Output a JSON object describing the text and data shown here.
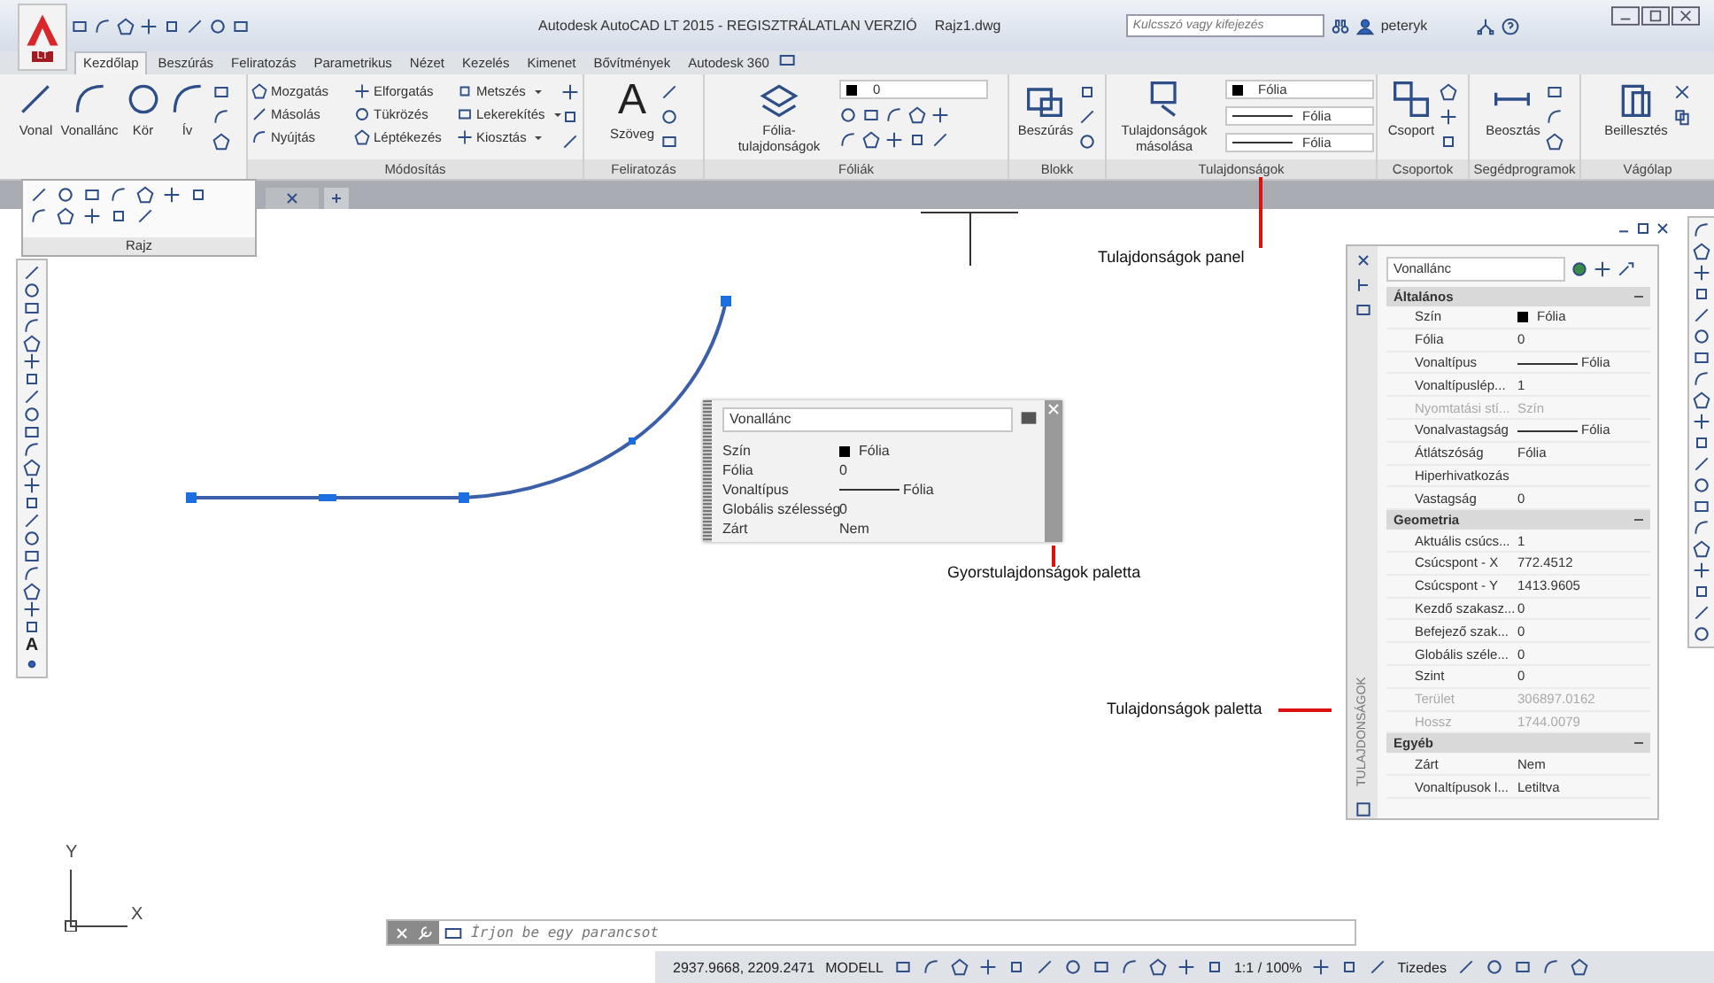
{
  "title_bar": {
    "app_badge": "LT",
    "title": "Autodesk AutoCAD LT 2015 - REGISZTRÁLATLAN VERZIÓ",
    "document": "Rajz1.dwg",
    "search": {
      "placeholder": "Kulcsszó vagy kifejezés"
    },
    "user": "peteryk"
  },
  "tabs": [
    {
      "label": "Kezdőlap",
      "selected": true
    },
    {
      "label": "Beszúrás",
      "selected": false
    },
    {
      "label": "Feliratozás",
      "selected": false
    },
    {
      "label": "Parametrikus",
      "selected": false
    },
    {
      "label": "Nézet",
      "selected": false
    },
    {
      "label": "Kezelés",
      "selected": false
    },
    {
      "label": "Kimenet",
      "selected": false
    },
    {
      "label": "Bővítmények",
      "selected": false
    },
    {
      "label": "Autodesk 360",
      "selected": false
    }
  ],
  "ribbon": {
    "draw": {
      "tools": [
        "Vonal",
        "Vonallánc",
        "Kör",
        "Ív"
      ]
    },
    "modify": {
      "title": "Módosítás",
      "tools": [
        "Mozgatás",
        "Elforgatás",
        "Metszés",
        "Másolás",
        "Tükrözés",
        "Lekerekítés",
        "Nyújtás",
        "Léptékezés",
        "Kiosztás"
      ]
    },
    "annotation": {
      "title": "Feliratozás",
      "tool": "Szöveg",
      "glyph": "A"
    },
    "layers": {
      "title": "Fóliák",
      "tool": "Fólia-tulajdonságok",
      "layer": "0"
    },
    "block": {
      "title": "Blokk",
      "tool": "Beszúrás"
    },
    "properties": {
      "title": "Tulajdonságok",
      "tool": "Tulajdonságok másolása",
      "color_text": "Fólia",
      "linetype": "Fólia",
      "lineweight": "Fólia"
    },
    "groups": {
      "title": "Csoportok",
      "tool": "Csoport"
    },
    "utilities": {
      "title": "Segédprogramok",
      "tool": "Beosztás"
    },
    "clipboard": {
      "title": "Vágólap",
      "tool": "Beillesztés"
    }
  },
  "draw_flyout": {
    "title": "Rajz"
  },
  "left_toolbar": {
    "glyph": "A"
  },
  "quick_properties": {
    "object": "Vonallánc",
    "rows": [
      {
        "label": "Szín",
        "value": "Fólia",
        "kind": "color"
      },
      {
        "label": "Fólia",
        "value": "0",
        "kind": "text"
      },
      {
        "label": "Vonaltípus",
        "value": "Fólia",
        "kind": "linetype"
      },
      {
        "label": "Globális szélesség",
        "value": "0",
        "kind": "text"
      },
      {
        "label": "Zárt",
        "value": "Nem",
        "kind": "text"
      }
    ]
  },
  "properties_palette": {
    "side_title": "TULAJDONSÁGOK",
    "object": "Vonallánc",
    "sections": [
      {
        "title": "Általános",
        "expanded": true,
        "rows": [
          {
            "label": "Szín",
            "value": "Fólia",
            "kind": "color",
            "disabled": false
          },
          {
            "label": "Fólia",
            "value": "0",
            "kind": "text",
            "disabled": false
          },
          {
            "label": "Vonaltípus",
            "value": "Fólia",
            "kind": "linetype",
            "disabled": false
          },
          {
            "label": "Vonaltípuslép...",
            "value": "1",
            "kind": "text",
            "disabled": false
          },
          {
            "label": "Nyomtatási stí...",
            "value": "Szín",
            "kind": "text",
            "disabled": true
          },
          {
            "label": "Vonalvastagság",
            "value": "Fólia",
            "kind": "linetype",
            "disabled": false
          },
          {
            "label": "Átlátszóság",
            "value": "Fólia",
            "kind": "text",
            "disabled": false
          },
          {
            "label": "Hiperhivatkozás",
            "kind": "text",
            "disabled": false
          },
          {
            "label": "Vastagság",
            "value": "0",
            "kind": "text",
            "disabled": false
          }
        ]
      },
      {
        "title": "Geometria",
        "expanded": true,
        "rows": [
          {
            "label": "Aktuális csúcs...",
            "value": "1",
            "kind": "text",
            "disabled": false
          },
          {
            "label": "Csúcspont - X",
            "value": "772.4512",
            "kind": "text",
            "disabled": false
          },
          {
            "label": "Csúcspont - Y",
            "value": "1413.9605",
            "kind": "text",
            "disabled": false
          },
          {
            "label": "Kezdő szakasz...",
            "value": "0",
            "kind": "text",
            "disabled": false
          },
          {
            "label": "Befejező szak...",
            "value": "0",
            "kind": "text",
            "disabled": false
          },
          {
            "label": "Globális széle...",
            "value": "0",
            "kind": "text",
            "disabled": false
          },
          {
            "label": "Szint",
            "value": "0",
            "kind": "text",
            "disabled": false
          },
          {
            "label": "Terület",
            "value": "306897.0162",
            "kind": "text",
            "disabled": true
          },
          {
            "label": "Hossz",
            "value": "1744.0079",
            "kind": "text",
            "disabled": true
          }
        ]
      },
      {
        "title": "Egyéb",
        "expanded": true,
        "rows": [
          {
            "label": "Zárt",
            "value": "Nem",
            "kind": "text",
            "disabled": false
          },
          {
            "label": "Vonaltípusok l...",
            "value": "Letiltva",
            "kind": "text",
            "disabled": false
          }
        ]
      }
    ]
  },
  "callouts": {
    "panel": "Tulajdonságok panel",
    "quick": "Gyorstulajdonságok paletta",
    "palette": "Tulajdonságok paletta"
  },
  "ucs": {
    "x": "X",
    "y": "Y"
  },
  "command_line": {
    "placeholder": "Írjon be egy parancsot"
  },
  "status_bar": {
    "coordinates": "2937.9668, 2209.2471",
    "space": "MODELL",
    "scale": "1:1 / 100%",
    "units": "Tizedes"
  }
}
